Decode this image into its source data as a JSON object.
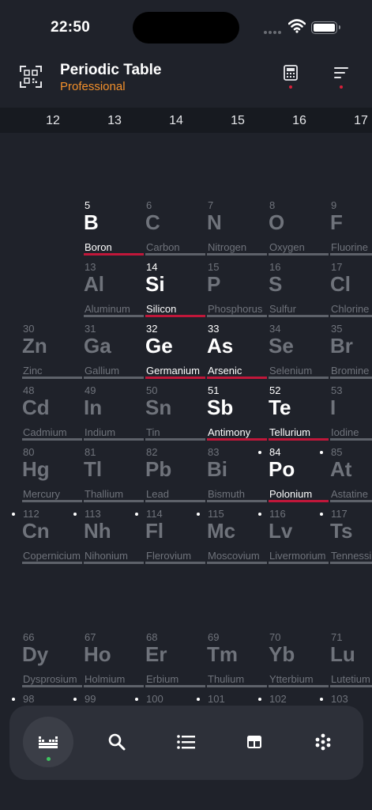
{
  "status": {
    "time": "22:50"
  },
  "header": {
    "title": "Periodic Table",
    "subtitle": "Professional"
  },
  "groups": [
    "12",
    "13",
    "14",
    "15",
    "16",
    "17"
  ],
  "elements": [
    {
      "num": "5",
      "sym": "B",
      "name": "Boron",
      "col": 1,
      "row": 0,
      "hl": true
    },
    {
      "num": "6",
      "sym": "C",
      "name": "Carbon",
      "col": 2,
      "row": 0
    },
    {
      "num": "7",
      "sym": "N",
      "name": "Nitrogen",
      "col": 3,
      "row": 0
    },
    {
      "num": "8",
      "sym": "O",
      "name": "Oxygen",
      "col": 4,
      "row": 0
    },
    {
      "num": "9",
      "sym": "F",
      "name": "Fluorine",
      "col": 5,
      "row": 0
    },
    {
      "num": "13",
      "sym": "Al",
      "name": "Aluminum",
      "col": 1,
      "row": 1
    },
    {
      "num": "14",
      "sym": "Si",
      "name": "Silicon",
      "col": 2,
      "row": 1,
      "hl": true
    },
    {
      "num": "15",
      "sym": "P",
      "name": "Phosphorus",
      "col": 3,
      "row": 1
    },
    {
      "num": "16",
      "sym": "S",
      "name": "Sulfur",
      "col": 4,
      "row": 1
    },
    {
      "num": "17",
      "sym": "Cl",
      "name": "Chlorine",
      "col": 5,
      "row": 1
    },
    {
      "num": "30",
      "sym": "Zn",
      "name": "Zinc",
      "col": 0,
      "row": 2
    },
    {
      "num": "31",
      "sym": "Ga",
      "name": "Gallium",
      "col": 1,
      "row": 2
    },
    {
      "num": "32",
      "sym": "Ge",
      "name": "Germanium",
      "col": 2,
      "row": 2,
      "hl": true
    },
    {
      "num": "33",
      "sym": "As",
      "name": "Arsenic",
      "col": 3,
      "row": 2,
      "hl": true
    },
    {
      "num": "34",
      "sym": "Se",
      "name": "Selenium",
      "col": 4,
      "row": 2
    },
    {
      "num": "35",
      "sym": "Br",
      "name": "Bromine",
      "col": 5,
      "row": 2
    },
    {
      "num": "48",
      "sym": "Cd",
      "name": "Cadmium",
      "col": 0,
      "row": 3
    },
    {
      "num": "49",
      "sym": "In",
      "name": "Indium",
      "col": 1,
      "row": 3
    },
    {
      "num": "50",
      "sym": "Sn",
      "name": "Tin",
      "col": 2,
      "row": 3
    },
    {
      "num": "51",
      "sym": "Sb",
      "name": "Antimony",
      "col": 3,
      "row": 3,
      "hl": true
    },
    {
      "num": "52",
      "sym": "Te",
      "name": "Tellurium",
      "col": 4,
      "row": 3,
      "hl": true
    },
    {
      "num": "53",
      "sym": "I",
      "name": "Iodine",
      "col": 5,
      "row": 3
    },
    {
      "num": "80",
      "sym": "Hg",
      "name": "Mercury",
      "col": 0,
      "row": 4
    },
    {
      "num": "81",
      "sym": "Tl",
      "name": "Thallium",
      "col": 1,
      "row": 4
    },
    {
      "num": "82",
      "sym": "Pb",
      "name": "Lead",
      "col": 2,
      "row": 4
    },
    {
      "num": "83",
      "sym": "Bi",
      "name": "Bismuth",
      "col": 3,
      "row": 4
    },
    {
      "num": "84",
      "sym": "Po",
      "name": "Polonium",
      "col": 4,
      "row": 4,
      "hl": true,
      "mark": true
    },
    {
      "num": "85",
      "sym": "At",
      "name": "Astatine",
      "col": 5,
      "row": 4,
      "mark": true
    },
    {
      "num": "112",
      "sym": "Cn",
      "name": "Copernicium",
      "col": 0,
      "row": 5,
      "mark": true
    },
    {
      "num": "113",
      "sym": "Nh",
      "name": "Nihonium",
      "col": 1,
      "row": 5,
      "mark": true
    },
    {
      "num": "114",
      "sym": "Fl",
      "name": "Flerovium",
      "col": 2,
      "row": 5,
      "mark": true
    },
    {
      "num": "115",
      "sym": "Mc",
      "name": "Moscovium",
      "col": 3,
      "row": 5,
      "mark": true
    },
    {
      "num": "116",
      "sym": "Lv",
      "name": "Livermorium",
      "col": 4,
      "row": 5,
      "mark": true
    },
    {
      "num": "117",
      "sym": "Ts",
      "name": "Tennessine",
      "col": 5,
      "row": 5,
      "mark": true
    },
    {
      "num": "66",
      "sym": "Dy",
      "name": "Dysprosium",
      "col": 0,
      "row": 7
    },
    {
      "num": "67",
      "sym": "Ho",
      "name": "Holmium",
      "col": 1,
      "row": 7
    },
    {
      "num": "68",
      "sym": "Er",
      "name": "Erbium",
      "col": 2,
      "row": 7
    },
    {
      "num": "69",
      "sym": "Tm",
      "name": "Thulium",
      "col": 3,
      "row": 7
    },
    {
      "num": "70",
      "sym": "Yb",
      "name": "Ytterbium",
      "col": 4,
      "row": 7
    },
    {
      "num": "71",
      "sym": "Lu",
      "name": "Lutetium",
      "col": 5,
      "row": 7
    },
    {
      "num": "98",
      "sym": "",
      "name": "",
      "col": 0,
      "row": 8,
      "mark": true
    },
    {
      "num": "99",
      "sym": "",
      "name": "",
      "col": 1,
      "row": 8,
      "mark": true
    },
    {
      "num": "100",
      "sym": "",
      "name": "",
      "col": 2,
      "row": 8,
      "mark": true
    },
    {
      "num": "101",
      "sym": "",
      "name": "",
      "col": 3,
      "row": 8,
      "mark": true
    },
    {
      "num": "102",
      "sym": "",
      "name": "",
      "col": 4,
      "row": 8,
      "mark": true
    },
    {
      "num": "103",
      "sym": "",
      "name": "",
      "col": 5,
      "row": 8,
      "mark": true
    }
  ],
  "tabs": [
    {
      "icon": "periodic-table-icon",
      "active": true
    },
    {
      "icon": "search-icon"
    },
    {
      "icon": "list-icon"
    },
    {
      "icon": "table-icon"
    },
    {
      "icon": "atom-dots-icon"
    }
  ],
  "colors": {
    "accent": "#f3902b",
    "highlight": "#c0173a",
    "background": "#1f222a",
    "active_tab_dot": "#3ec45f"
  }
}
